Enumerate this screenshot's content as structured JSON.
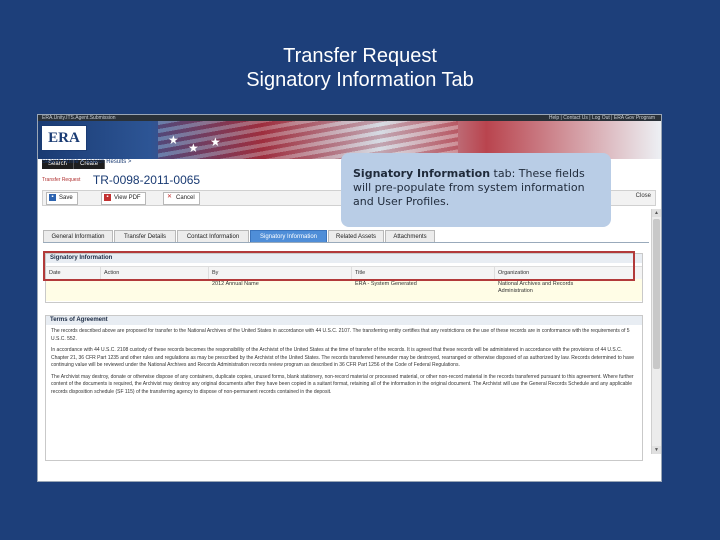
{
  "slide": {
    "title_line1": "Transfer Request",
    "title_line2": "Signatory Information Tab"
  },
  "app": {
    "topbar_left": "ERA.Unity.ITS.Agent.Submission",
    "topbar_right": "Help | Contact Us | Log Out | ERA Gov Program",
    "logo": "ERA",
    "nav_tabs": [
      "Search",
      "Create"
    ],
    "breadcrumb": "Search Home > Search Results >",
    "request_label": "Transfer Request",
    "request_id": "TR-0098-2011-0065",
    "toolbar": {
      "save": "Save",
      "view_pdf": "View PDF",
      "cancel": "Cancel",
      "right_label": "Close"
    },
    "tabs": [
      "General Information",
      "Transfer Details",
      "Contact Information",
      "Signatory Information",
      "Related Assets",
      "Attachments"
    ],
    "active_tab": "Signatory Information",
    "signatory": {
      "heading": "Signatory Information",
      "columns": [
        "Date",
        "Action",
        "By",
        "Title",
        "Organization"
      ],
      "row": {
        "date": "",
        "action": "",
        "by": "2012 Annual Name",
        "title": "ERA - System Generated",
        "organization_line1": "National Archives and Records",
        "organization_line2": "Administration"
      }
    },
    "terms": {
      "heading": "Terms of Agreement",
      "paragraphs": [
        "The records described above are proposed for transfer to the National Archives of the United States in accordance with 44 U.S.C. 2107. The transferring entity certifies that any restrictions on the use of these records are in conformance with the requirements of 5 U.S.C. 552.",
        "In accordance with 44 U.S.C. 2108 custody of these records becomes the responsibility of the Archivist of the United States at the time of transfer of the records. It is agreed that these records will be administered in accordance with the provisions of 44 U.S.C. Chapter 21, 36 CFR Part 1235 and other rules and regulations as may be prescribed by the Archivist of the United States. The records transferred hereunder may be destroyed, rearranged or otherwise disposed of as authorized by law. Records determined to have continuing value will be reviewed under the National Archives and Records Administration records review program as described in 36 CFR Part 1256 of the Code of Federal Regulations.",
        "The Archivist may destroy, donate or otherwise dispose of any containers, duplicate copies, unused forms, blank stationery, non-record material or processed material, or other non-record material in the records transferred pursuant to this agreement. Where further content of the documents is required, the Archivist may destroy any original documents after they have been copied in a suitant format, retaining all of the information in the original document. The Archivist will use the General Records Schedule and any applicable records disposition schedule (SF 115) of the transferring agency to dispose of non-permanent records contained in the deposit."
      ]
    },
    "callout": {
      "bold": "Signatory Information",
      "rest": " tab: These fields will pre-populate from system information and User Profiles."
    }
  },
  "colors": {
    "slide_background": "#1d3f7a",
    "active_tab": "#4f8ed8",
    "highlight_border": "#b23a3a",
    "callout_background": "#b9cde6"
  }
}
